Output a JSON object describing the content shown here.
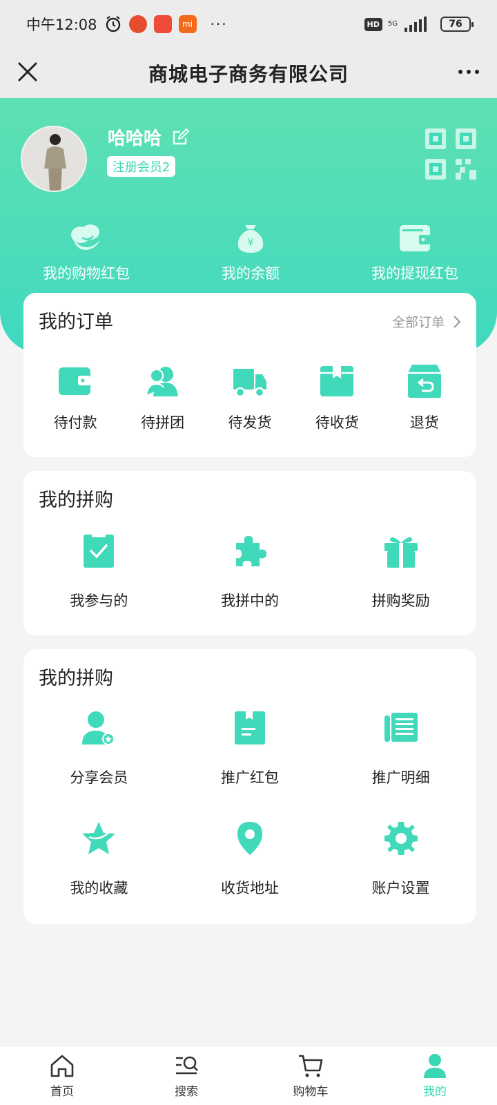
{
  "status_bar": {
    "time": "中午12:08",
    "battery": "76",
    "network": "5G",
    "hd": "HD"
  },
  "nav": {
    "title": "商城电子商务有限公司"
  },
  "profile": {
    "username": "哈哈哈",
    "member_level": "注册会员2"
  },
  "wallet": [
    {
      "label": "我的购物红包",
      "icon": "red-envelope-icon"
    },
    {
      "label": "我的余额",
      "icon": "money-bag-icon"
    },
    {
      "label": "我的提现红包",
      "icon": "wallet-icon"
    }
  ],
  "orders": {
    "title": "我的订单",
    "all_label": "全部订单",
    "items": [
      {
        "label": "待付款",
        "icon": "wallet-icon"
      },
      {
        "label": "待拼团",
        "icon": "users-icon"
      },
      {
        "label": "待发货",
        "icon": "truck-icon"
      },
      {
        "label": "待收货",
        "icon": "box-icon"
      },
      {
        "label": "退货",
        "icon": "return-box-icon"
      }
    ]
  },
  "group_buy": {
    "title": "我的拼购",
    "items": [
      {
        "label": "我参与的",
        "icon": "clipboard-check-icon"
      },
      {
        "label": "我拼中的",
        "icon": "puzzle-icon"
      },
      {
        "label": "拼购奖励",
        "icon": "gift-icon"
      }
    ]
  },
  "promotion": {
    "title": "我的拼购",
    "items": [
      {
        "label": "分享会员",
        "icon": "user-star-icon"
      },
      {
        "label": "推广红包",
        "icon": "document-icon"
      },
      {
        "label": "推广明细",
        "icon": "list-detail-icon"
      },
      {
        "label": "我的收藏",
        "icon": "star-icon"
      },
      {
        "label": "收货地址",
        "icon": "location-pin-icon"
      },
      {
        "label": "账户设置",
        "icon": "gear-icon"
      }
    ]
  },
  "tabbar": [
    {
      "label": "首页",
      "icon": "home-icon",
      "active": false
    },
    {
      "label": "搜索",
      "icon": "search-icon",
      "active": false
    },
    {
      "label": "购物车",
      "icon": "cart-icon",
      "active": false
    },
    {
      "label": "我的",
      "icon": "profile-icon",
      "active": true
    }
  ],
  "colors": {
    "accent": "#3ad7b5",
    "hero_top": "#5fe0b3",
    "hero_bottom": "#3fd9bf"
  }
}
